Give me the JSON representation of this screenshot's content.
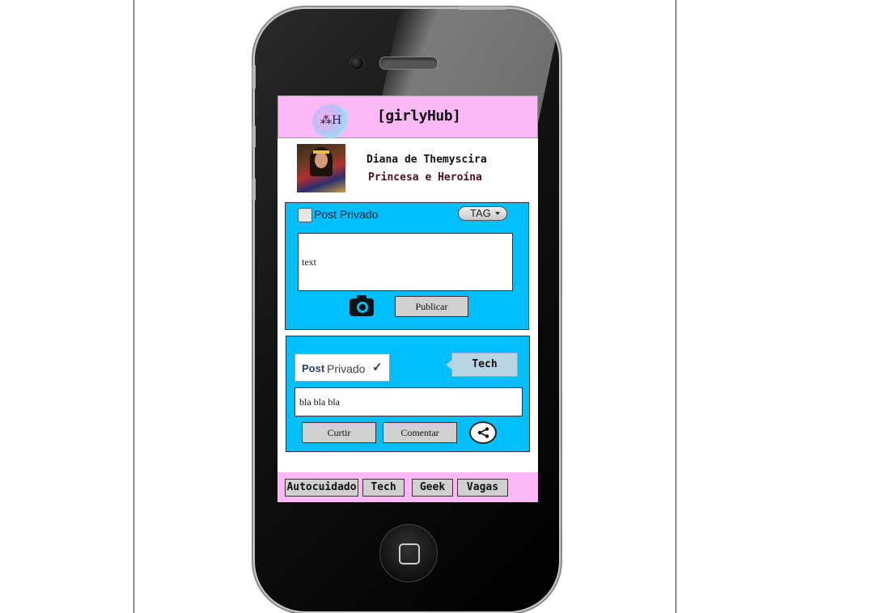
{
  "app": {
    "title": "[girlyHub]",
    "logo_text": "⁂H"
  },
  "profile": {
    "name": "Diana de Themyscira",
    "role": "Princesa e Heroína"
  },
  "composer": {
    "private_checkbox_label": "Post Privado",
    "tag_button_label": "TAG",
    "text_value": "text",
    "publish_label": "Publicar"
  },
  "post": {
    "privacy_label": "Post",
    "privacy_value": "Privado",
    "privacy_check": "✓",
    "tag": "Tech",
    "body": "bla bla bla",
    "like_label": "Curtir",
    "comment_label": "Comentar"
  },
  "nav": {
    "items": [
      {
        "label": "Autocuidado"
      },
      {
        "label": "Tech"
      },
      {
        "label": "Geek"
      },
      {
        "label": "Vagas"
      }
    ]
  },
  "colors": {
    "header_pink": "#fbb9f6",
    "panel_cyan": "#00bfff",
    "button_gray": "#d0d0d0"
  }
}
